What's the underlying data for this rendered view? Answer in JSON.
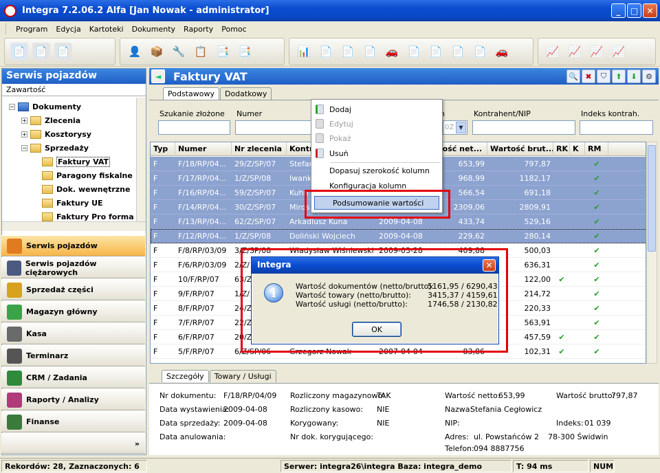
{
  "window": {
    "title": "Integra 7.2.06.2 Alfa [Jan Nowak - administrator]"
  },
  "menu": [
    "Program",
    "Edycja",
    "Kartoteki",
    "Dokumenty",
    "Raporty",
    "Pomoc"
  ],
  "left": {
    "header": "Serwis pojazdów",
    "subheader": "Zawartość",
    "tree": [
      {
        "label": "Dokumenty",
        "level": 0,
        "expander": "−"
      },
      {
        "label": "Zlecenia",
        "level": 1,
        "expander": "+"
      },
      {
        "label": "Kosztorysy",
        "level": 1,
        "expander": "+"
      },
      {
        "label": "Sprzedaży",
        "level": 1,
        "expander": "−"
      },
      {
        "label": "Faktury VAT",
        "level": 2,
        "expander": ""
      },
      {
        "label": "Paragony fiskalne",
        "level": 2,
        "expander": ""
      },
      {
        "label": "Dok. wewnętrzne",
        "level": 2,
        "expander": ""
      },
      {
        "label": "Faktury UE",
        "level": 2,
        "expander": ""
      },
      {
        "label": "Faktury Pro forma",
        "level": 2,
        "expander": ""
      }
    ],
    "nav": [
      {
        "label": "Serwis pojazdów",
        "color": "#e07b1f"
      },
      {
        "label": "Serwis pojazdów ciężarowych",
        "color": "#4a5a80"
      },
      {
        "label": "Sprzedaż części",
        "color": "#d8a21c"
      },
      {
        "label": "Magazyn główny",
        "color": "#3aa34a"
      },
      {
        "label": "Kasa",
        "color": "#6a6a6a"
      },
      {
        "label": "Terminarz",
        "color": "#555555"
      },
      {
        "label": "CRM / Zadania",
        "color": "#2e8a3c"
      },
      {
        "label": "Raporty / Analizy",
        "color": "#b03a7a"
      },
      {
        "label": "Finanse",
        "color": "#3a7a3a"
      }
    ]
  },
  "main": {
    "title": "Faktury VAT",
    "tabs": [
      "Podstawowy",
      "Dodatkowy"
    ],
    "search": {
      "labels": [
        "Szukanie złożone",
        "Numer",
        "n",
        "Kontrahent/NIP",
        "Indeks kontrah."
      ],
      "combo_value": "0Z"
    },
    "columns": [
      "Typ",
      "Numer",
      "Nr zlecenia",
      "Kontra",
      "",
      "rtość net...",
      "Wartość brut...",
      "RK",
      "K",
      "RM"
    ],
    "rows": [
      {
        "typ": "F",
        "numer": "F/18/RP/04...",
        "zlec": "29/Z/SP/07",
        "kontr": "Stefan",
        "data": "",
        "net": "653,99",
        "brut": "797,87",
        "rk": "",
        "k": "",
        "rm": "✔",
        "sel": true
      },
      {
        "typ": "F",
        "numer": "F/17/RP/04...",
        "zlec": "1/Z/SP/08",
        "kontr": "Iwanko",
        "data": "",
        "net": "968,99",
        "brut": "1182,17",
        "rk": "",
        "k": "",
        "rm": "✔",
        "sel": true
      },
      {
        "typ": "F",
        "numer": "F/16/RP/04...",
        "zlec": "59/Z/SP/07",
        "kontr": "Kuhn",
        "data": "",
        "net": "566,54",
        "brut": "691,18",
        "rk": "",
        "k": "",
        "rm": "✔",
        "sel": true
      },
      {
        "typ": "F",
        "numer": "F/14/RP/04...",
        "zlec": "30/Z/SP/07",
        "kontr": "Miros",
        "data": "",
        "net": "2309,06",
        "brut": "2809,91",
        "rk": "",
        "k": "",
        "rm": "✔",
        "sel": true
      },
      {
        "typ": "F",
        "numer": "F/13/RP/04...",
        "zlec": "62/Z/SP/07",
        "kontr": "Arkadiusz Kuna",
        "data": "2009-04-08",
        "net": "433,74",
        "brut": "529,16",
        "rk": "",
        "k": "",
        "rm": "✔",
        "sel": true
      },
      {
        "typ": "F",
        "numer": "F/12/RP/04...",
        "zlec": "1/Z/SP/08",
        "kontr": "Doliński Wojciech",
        "data": "2009-04-08",
        "net": "229,62",
        "brut": "280,14",
        "rk": "",
        "k": "",
        "rm": "✔",
        "sel": true
      },
      {
        "typ": "F",
        "numer": "F/8/RP/03/09",
        "zlec": "3/Z/SP/08",
        "kontr": "Władysław Wiśniewski",
        "data": "2009-03-28",
        "net": "409,88",
        "brut": "500,03",
        "rk": "",
        "k": "",
        "rm": "✔",
        "sel": false
      },
      {
        "typ": "F",
        "numer": "F/6/RP/03/09",
        "zlec": "2/Z/",
        "kontr": "",
        "data": "",
        "net": "",
        "brut": "636,31",
        "rk": "",
        "k": "",
        "rm": "✔",
        "sel": false
      },
      {
        "typ": "F",
        "numer": "10/F/RP/07",
        "zlec": "63/Z/",
        "kontr": "",
        "data": "",
        "net": "",
        "brut": "122,00",
        "rk": "✔",
        "k": "",
        "rm": "✔",
        "sel": false
      },
      {
        "typ": "F",
        "numer": "9/F/RP/07",
        "zlec": "1/Z/",
        "kontr": "",
        "data": "",
        "net": "",
        "brut": "214,72",
        "rk": "",
        "k": "",
        "rm": "✔",
        "sel": false
      },
      {
        "typ": "F",
        "numer": "8/F/RP/07",
        "zlec": "24/Z/",
        "kontr": "",
        "data": "",
        "net": "",
        "brut": "220,33",
        "rk": "",
        "k": "",
        "rm": "✔",
        "sel": false
      },
      {
        "typ": "F",
        "numer": "7/F/RP/07",
        "zlec": "22/Z/",
        "kontr": "",
        "data": "",
        "net": "",
        "brut": "563,91",
        "rk": "",
        "k": "",
        "rm": "✔",
        "sel": false
      },
      {
        "typ": "F",
        "numer": "6/F/RP/07",
        "zlec": "20/Z/",
        "kontr": "",
        "data": "",
        "net": "",
        "brut": "457,59",
        "rk": "✔",
        "k": "",
        "rm": "✔",
        "sel": false
      },
      {
        "typ": "F",
        "numer": "5/F/RP/07",
        "zlec": "6/Z/SP/06",
        "kontr": "Grzegorz Nowak",
        "data": "2007-04-04",
        "net": "83,86",
        "brut": "102,31",
        "rk": "✔",
        "k": "",
        "rm": "✔",
        "sel": false
      }
    ]
  },
  "context_menu": {
    "items": [
      {
        "label": "Dodaj",
        "disabled": false,
        "icon": "add-doc-icon"
      },
      {
        "label": "Edytuj",
        "disabled": true,
        "icon": "edit-doc-icon"
      },
      {
        "label": "Pokaż",
        "disabled": true,
        "icon": "view-doc-icon"
      },
      {
        "label": "Usuń",
        "disabled": false,
        "icon": "delete-doc-icon"
      },
      {
        "label": "Dopasuj szerokość kolumn",
        "disabled": false,
        "icon": ""
      },
      {
        "label": "Konfiguracja kolumn",
        "disabled": false,
        "icon": ""
      },
      {
        "label": "Podsumowanie wartości",
        "disabled": false,
        "icon": "",
        "highlight": true
      }
    ]
  },
  "dialog": {
    "title": "Integra",
    "lines": [
      {
        "label": "Wartość dokumentów (netto/brutto):",
        "value": "5161,95 / 6290,43"
      },
      {
        "label": "Wartość towary (netto/brutto):",
        "value": "3415,37 / 4159,61"
      },
      {
        "label": "Wartość usługi (netto/brutto):",
        "value": "1746,58 / 2130,82"
      }
    ],
    "ok": "OK"
  },
  "details": {
    "tabs": [
      "Szczegóły",
      "Towary / Usługi"
    ],
    "nr_dok_label": "Nr dokumentu:",
    "nr_dok": "F/18/RP/04/09",
    "data_wyst_label": "Data wystawienia:",
    "data_wyst": "2009-04-08",
    "data_sprz_label": "Data sprzedaży:",
    "data_sprz": "2009-04-08",
    "data_anul_label": "Data anulowania:",
    "rozl_mag_label": "Rozliczony magazynowo:",
    "rozl_mag": "TAK",
    "rozl_kas_label": "Rozliczony kasowo:",
    "rozl_kas": "NIE",
    "koryg_label": "Korygowany:",
    "koryg": "NIE",
    "nr_koryg_label": "Nr dok. korygującego:",
    "netto_label": "Wartość netto:",
    "netto": "653,99",
    "brutto_label": "Wartość brutto:",
    "brutto": "797,87",
    "nazwa_label": "Nazwa:",
    "nazwa": "Stefania Cegłowicz",
    "nip_label": "NIP:",
    "indeks_label": "Indeks:",
    "indeks": "01 039",
    "adres_label": "Adres:",
    "adres": "ul. Powstańców 2",
    "miasto": "78-300 Świdwin",
    "telefon_label": "Telefon:",
    "telefon": "094 8887756"
  },
  "status": {
    "records": "Rekordów: 28, Zaznaczonych: 6",
    "server": "Serwer: integra26\\integra  Baza: integra_demo",
    "time": "T: 94 ms",
    "num": "NUM"
  }
}
